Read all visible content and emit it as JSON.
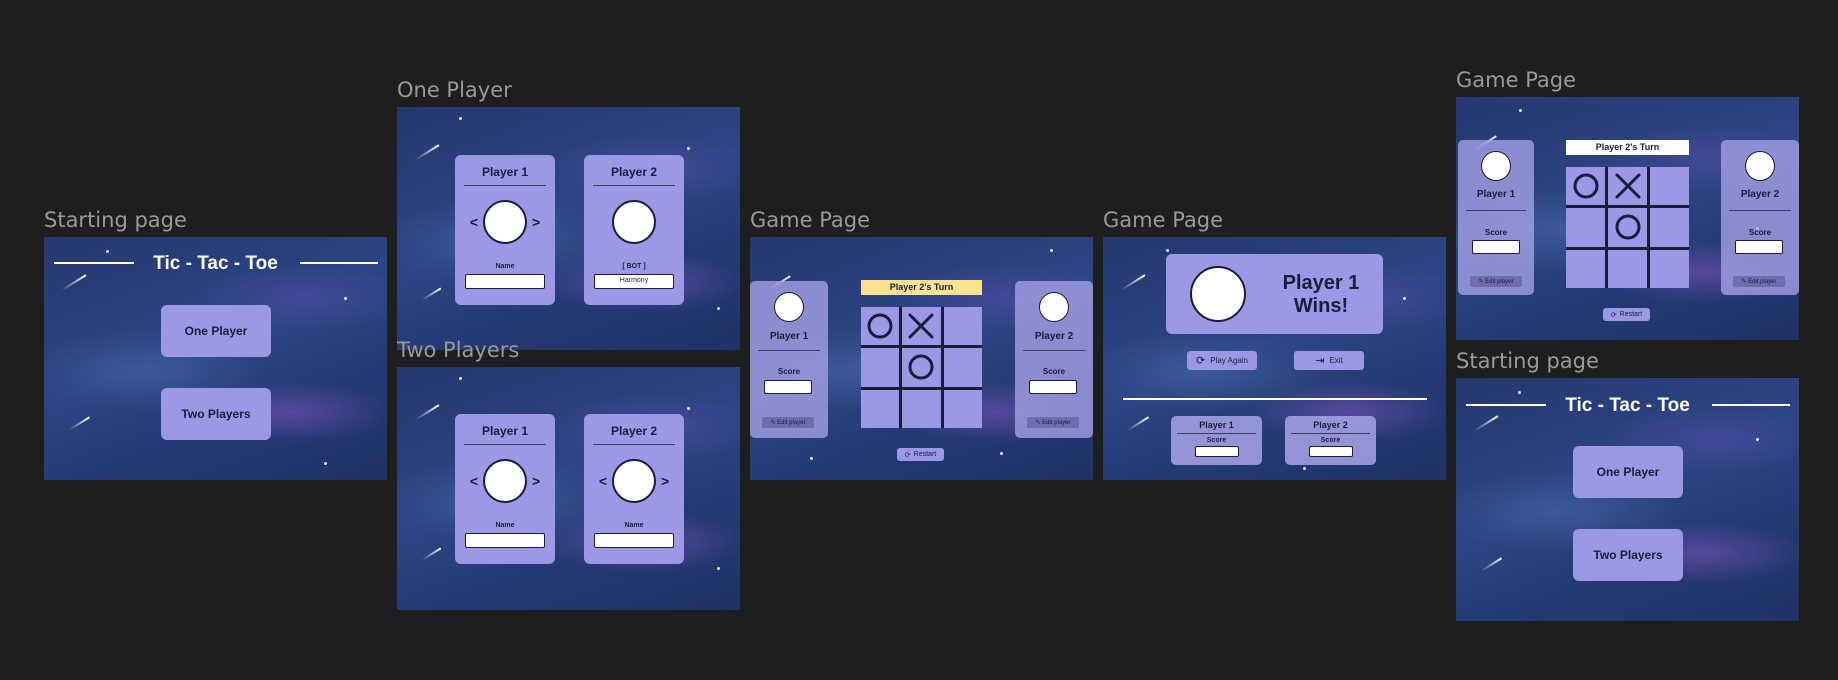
{
  "frames": {
    "start1": {
      "label": "Starting page",
      "title": "Tic - Tac - Toe",
      "one_player": "One Player",
      "two_players": "Two Players"
    },
    "one_player": {
      "label": "One Player",
      "p1": {
        "name": "Player 1",
        "field_label": "Name",
        "field_value": ""
      },
      "p2": {
        "name": "Player 2",
        "field_label": "[ BOT ]",
        "field_value": "Harmony"
      }
    },
    "two_players": {
      "label": "Two Players",
      "p1": {
        "name": "Player 1",
        "field_label": "Name",
        "field_value": ""
      },
      "p2": {
        "name": "Player 2",
        "field_label": "Name",
        "field_value": ""
      }
    },
    "game1": {
      "label": "Game Page",
      "turn": "Player 2's Turn",
      "p1": {
        "name": "Player 1",
        "score_label": "Score",
        "edit": "Edit player"
      },
      "p2": {
        "name": "Player 2",
        "score_label": "Score",
        "edit": "Edit player"
      },
      "restart": "Restart",
      "board": [
        "O",
        "X",
        "",
        "",
        "O",
        "",
        "",
        "",
        ""
      ]
    },
    "win": {
      "label": "Game Page",
      "win_line1": "Player 1",
      "win_line2": "Wins!",
      "play_again": "Play Again",
      "exit": "Exit",
      "p1": {
        "name": "Player 1",
        "score_label": "Score"
      },
      "p2": {
        "name": "Player 2",
        "score_label": "Score"
      }
    },
    "game2": {
      "label": "Game Page",
      "turn": "Player 2's Turn",
      "p1": {
        "name": "Player 1",
        "score_label": "Score",
        "edit": "Edit player"
      },
      "p2": {
        "name": "Player 2",
        "score_label": "Score",
        "edit": "Edit player"
      },
      "restart": "Restart",
      "board": [
        "O",
        "X",
        "",
        "",
        "O",
        "",
        "",
        "",
        ""
      ]
    },
    "start2": {
      "label": "Starting page",
      "title": "Tic - Tac - Toe",
      "one_player": "One Player",
      "two_players": "Two Players"
    }
  },
  "colors": {
    "background": "#1e1e1e",
    "card": "#9b98e6",
    "turn_yellow": "#fce28f",
    "turn_white": "#ffffff",
    "ink": "#1b1b3a"
  }
}
